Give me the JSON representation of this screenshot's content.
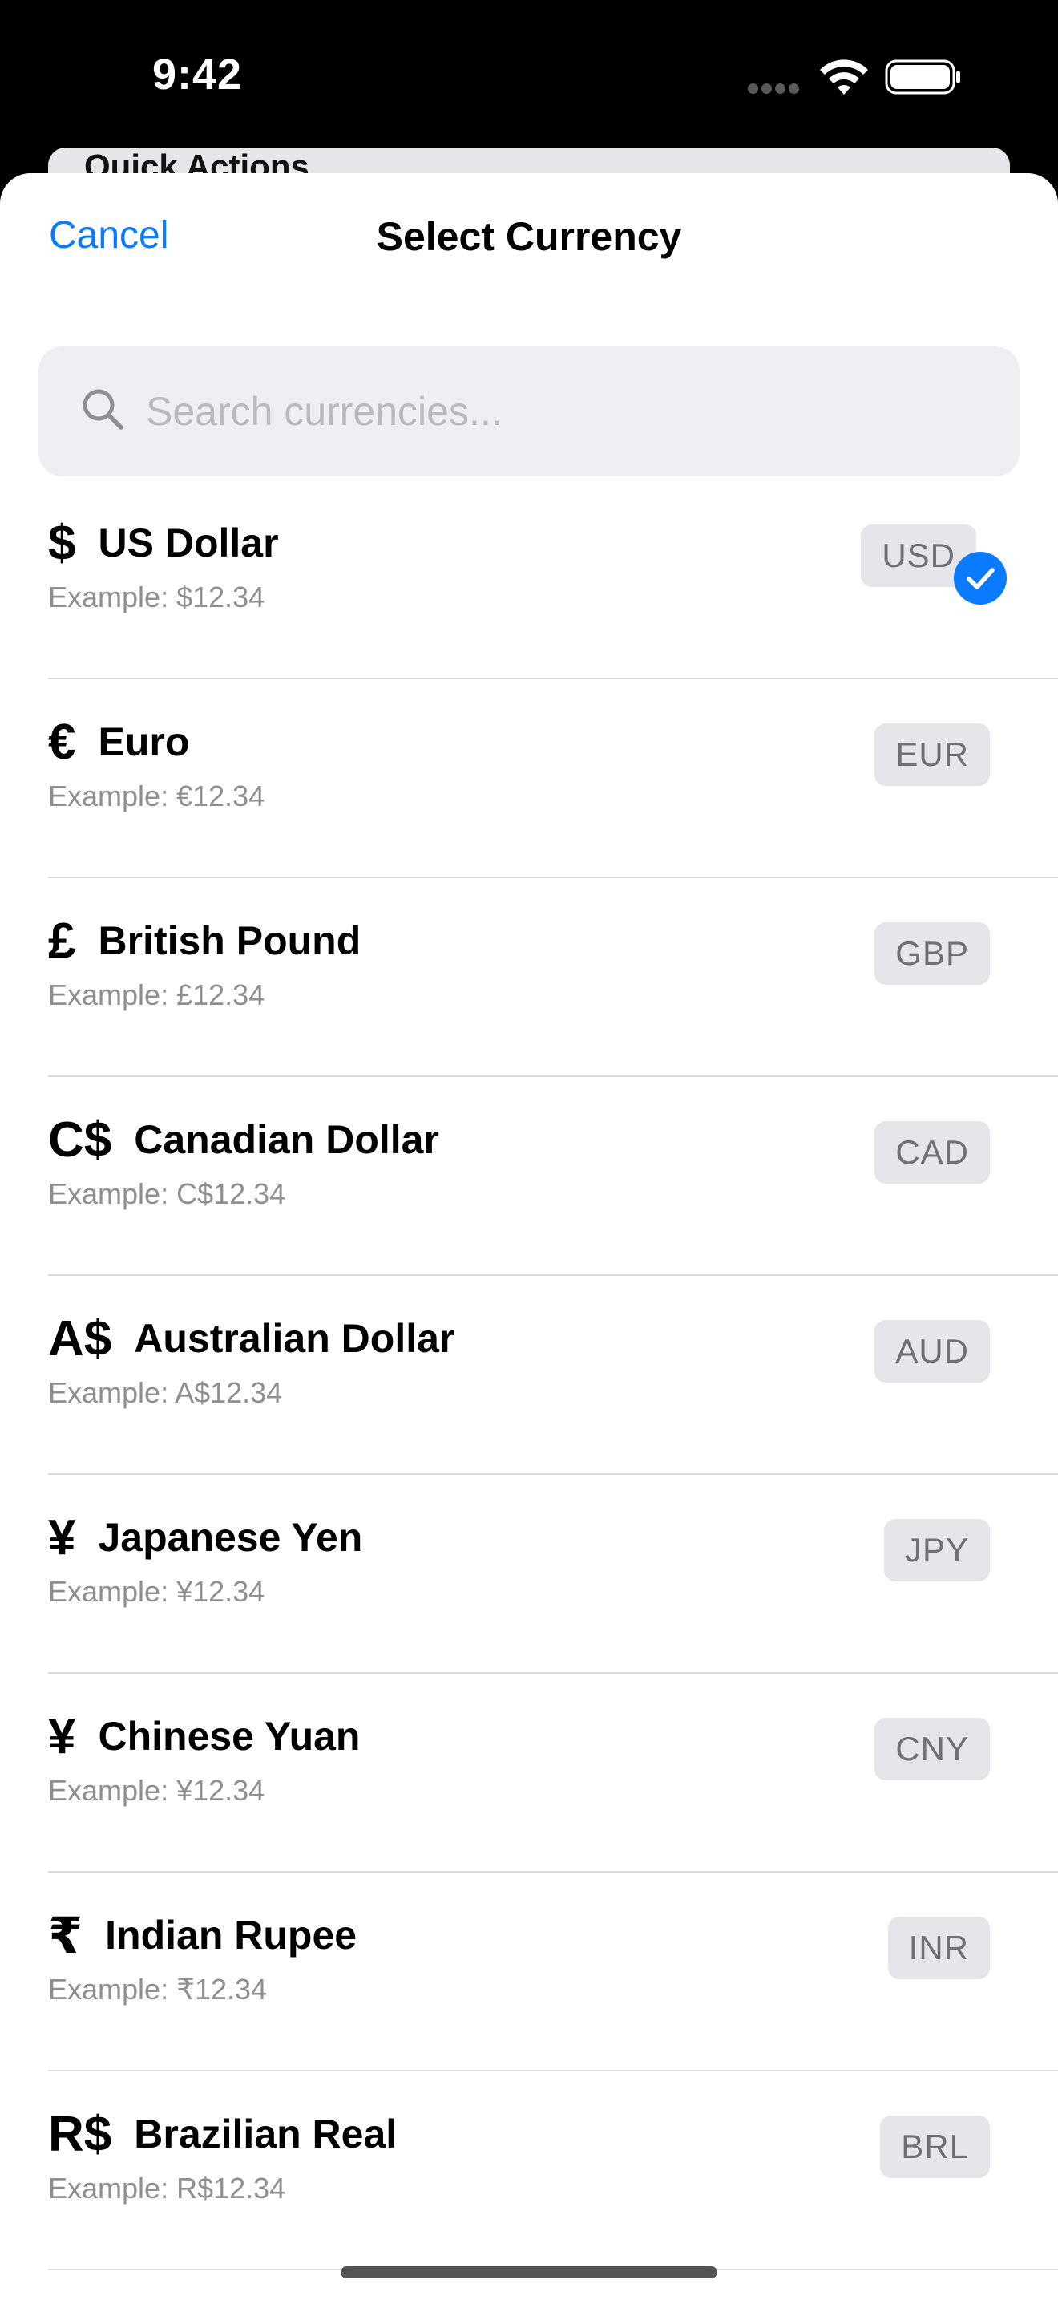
{
  "status_bar": {
    "time": "9:42"
  },
  "underlying": {
    "card_title": "Quick Actions"
  },
  "sheet": {
    "cancel_label": "Cancel",
    "title": "Select Currency",
    "search": {
      "placeholder": "Search currencies...",
      "value": ""
    },
    "currencies": [
      {
        "symbol": "$",
        "name": "US Dollar",
        "code": "USD",
        "example": "Example: $12.34",
        "selected": true
      },
      {
        "symbol": "€",
        "name": "Euro",
        "code": "EUR",
        "example": "Example: €12.34",
        "selected": false
      },
      {
        "symbol": "£",
        "name": "British Pound",
        "code": "GBP",
        "example": "Example: £12.34",
        "selected": false
      },
      {
        "symbol": "C$",
        "name": "Canadian Dollar",
        "code": "CAD",
        "example": "Example: C$12.34",
        "selected": false
      },
      {
        "symbol": "A$",
        "name": "Australian Dollar",
        "code": "AUD",
        "example": "Example: A$12.34",
        "selected": false
      },
      {
        "symbol": "¥",
        "name": "Japanese Yen",
        "code": "JPY",
        "example": "Example: ¥12.34",
        "selected": false
      },
      {
        "symbol": "¥",
        "name": "Chinese Yuan",
        "code": "CNY",
        "example": "Example: ¥12.34",
        "selected": false
      },
      {
        "symbol": "₹",
        "name": "Indian Rupee",
        "code": "INR",
        "example": "Example: ₹12.34",
        "selected": false
      },
      {
        "symbol": "R$",
        "name": "Brazilian Real",
        "code": "BRL",
        "example": "Example: R$12.34",
        "selected": false
      }
    ]
  },
  "colors": {
    "accent": "#0a7aff",
    "badge_bg": "#e5e5ea",
    "secondary_text": "#8e8e93"
  },
  "icons": {
    "search": "search-icon",
    "selected": "checkmark-circle-icon",
    "wifi": "wifi-icon",
    "battery": "battery-icon"
  }
}
